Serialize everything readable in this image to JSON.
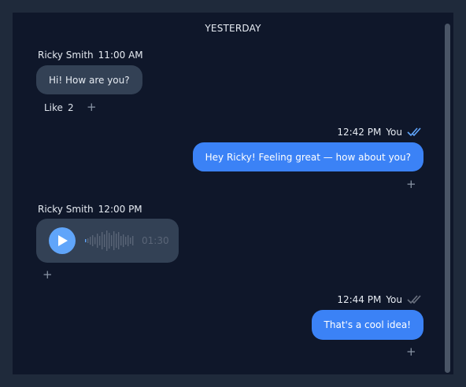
{
  "day_label": "YESTERDAY",
  "messages": [
    {
      "sender": "Ricky Smith",
      "time": "11:00 AM",
      "text": "Hi! How are you?",
      "reaction": {
        "label": "Like",
        "count": "2"
      }
    },
    {
      "sender": "You",
      "time": "12:42 PM",
      "text": "Hey Ricky! Feeling great — how about you?",
      "status": "read"
    },
    {
      "sender": "Ricky Smith",
      "time": "12:00 PM",
      "voice": {
        "duration": "01:30",
        "progress": 0
      }
    },
    {
      "sender": "You",
      "time": "12:44 PM",
      "text": "That's a cool idea!",
      "status": "delivered"
    }
  ],
  "icons": {
    "add_reaction": "plus-icon",
    "play": "play-icon",
    "read": "double-check-icon",
    "delivered": "double-check-icon"
  },
  "colors": {
    "background": "#0f172a",
    "incoming_bubble": "#334155",
    "outgoing_bubble": "#3b82f6",
    "play_button": "#60a5fa",
    "read_check": "#60a5fa",
    "delivered_check": "#6b7280"
  }
}
